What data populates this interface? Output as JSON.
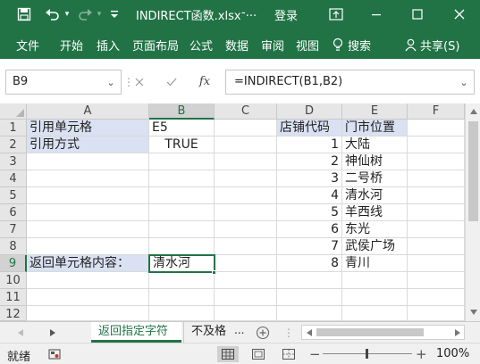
{
  "titlebar": {
    "filename": "INDIRECT函数.xlsx",
    "dash": "-...",
    "login": "登录",
    "icons": [
      "save-icon",
      "undo-icon",
      "redo-icon",
      "customize-icon",
      "ribbon-display-icon",
      "minimize-icon",
      "maximize-icon",
      "close-icon"
    ]
  },
  "ribbon": {
    "tabs": [
      "文件",
      "开始",
      "插入",
      "页面布局",
      "公式",
      "数据",
      "审阅",
      "视图"
    ],
    "search": "搜索",
    "share": "共享(S)"
  },
  "formulabar": {
    "namebox": "B9",
    "fx": "fx",
    "formula": "=INDIRECT(B1,B2)"
  },
  "columns": [
    "A",
    "B",
    "C",
    "D",
    "E",
    "F"
  ],
  "rows": [
    "1",
    "2",
    "3",
    "4",
    "5",
    "6",
    "7",
    "8",
    "9",
    "10",
    "11",
    "12"
  ],
  "cells": {
    "A1": "引用单元格",
    "B1": "E5",
    "A2": "引用方式",
    "B2": "TRUE",
    "A9": "返回单元格内容：",
    "B9": "清水河",
    "D1": "店铺代码",
    "E1": "门市位置",
    "D2": "1",
    "E2": "大陆",
    "D3": "2",
    "E3": "神仙树",
    "D4": "3",
    "E4": "二号桥",
    "D5": "4",
    "E5": "清水河",
    "D6": "5",
    "E6": "羊西线",
    "D7": "6",
    "E7": "东光",
    "D8": "7",
    "E8": "武侯广场",
    "D9": "8",
    "E9": "青川"
  },
  "sheets": {
    "active": "返回指定字符",
    "other": "不及格",
    "more": "..."
  },
  "status": {
    "ready": "就绪",
    "zoom": "100%"
  },
  "colors": {
    "accent": "#217346",
    "highlight": "#d9e1f2"
  }
}
